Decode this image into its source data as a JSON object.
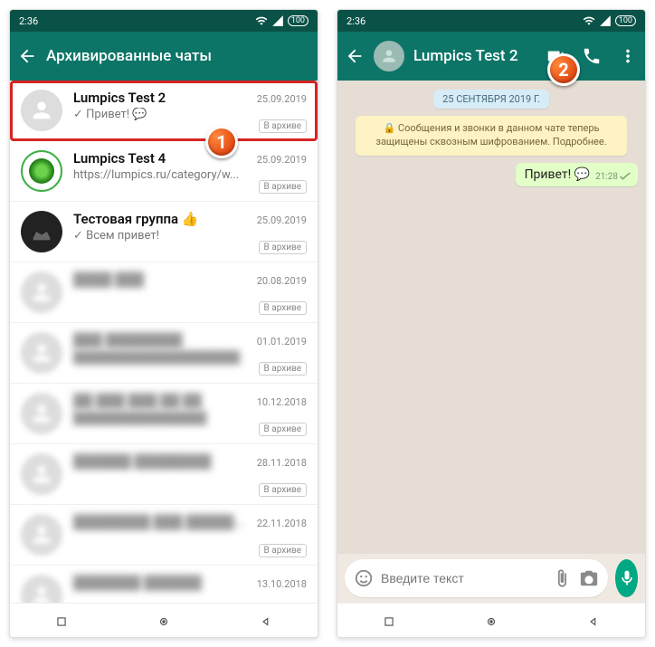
{
  "status": {
    "time": "2:36",
    "battery": "100"
  },
  "left": {
    "header": {
      "title": "Архивированные чаты"
    },
    "archive_label": "В архиве",
    "chats": [
      {
        "name": "Lumpics Test 2",
        "preview": "✓ Привет! 💬",
        "date": "25.09.2019",
        "highlight": true,
        "avatar": "default"
      },
      {
        "name": "Lumpics Test 4",
        "preview": "https://lumpics.ru/category/w...",
        "date": "25.09.2019",
        "avatar": "green"
      },
      {
        "name": "Тестовая группа 👍",
        "preview": "✓ Всем привет!",
        "date": "25.09.2019",
        "avatar": "dark"
      },
      {
        "name": "████ ███",
        "preview": "",
        "date": "20.08.2019",
        "blur": true
      },
      {
        "name": "███ ████████",
        "preview": "████████████████████",
        "date": "01.01.2019",
        "blur": true
      },
      {
        "name": "██ ███ ███ ██ ██",
        "preview": "████████████████",
        "date": "10.12.2018",
        "blur": true
      },
      {
        "name": "██████ ████████",
        "preview": "",
        "date": "28.11.2018",
        "blur": true
      },
      {
        "name": "████████ ███ ███████",
        "preview": "",
        "date": "22.11.2018",
        "blur": true
      },
      {
        "name": "███████ ██████",
        "preview": "",
        "date": "13.10.2018",
        "blur": true
      }
    ]
  },
  "right": {
    "header": {
      "title": "Lumpics Test 2"
    },
    "date_pill": "25 СЕНТЯБРЯ 2019 Г.",
    "encryption": "🔒 Сообщения и звонки в данном чате теперь защищены сквозным шифрованием. Подробнее.",
    "message": {
      "text": "Привет! 💬",
      "time": "21:28"
    },
    "input_placeholder": "Введите текст"
  },
  "badges": {
    "one": "1",
    "two": "2"
  }
}
